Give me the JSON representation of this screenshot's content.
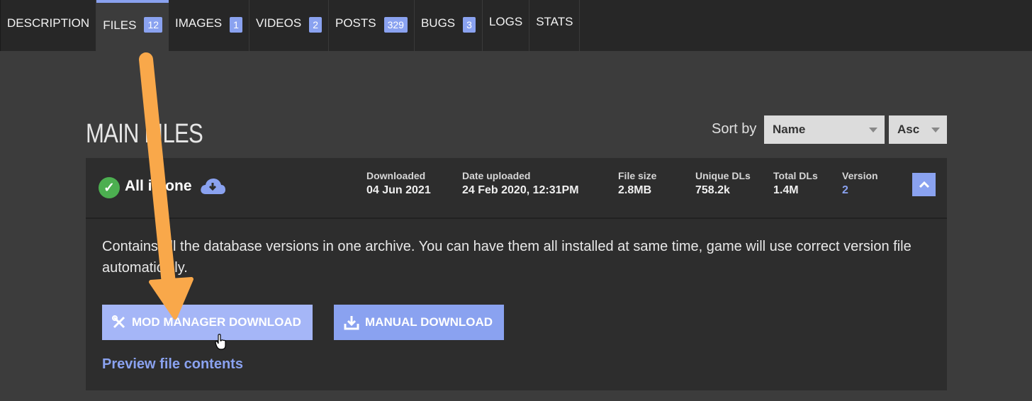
{
  "tabs": [
    {
      "label": "DESCRIPTION"
    },
    {
      "label": "FILES",
      "count": "12"
    },
    {
      "label": "IMAGES",
      "count": "1"
    },
    {
      "label": "VIDEOS",
      "count": "2"
    },
    {
      "label": "POSTS",
      "count": "329"
    },
    {
      "label": "BUGS",
      "count": "3"
    },
    {
      "label": "LOGS"
    },
    {
      "label": "STATS"
    }
  ],
  "active_tab": "FILES",
  "section": {
    "title": "MAIN FILES"
  },
  "sort": {
    "label": "Sort by",
    "field": "Name",
    "order": "Asc"
  },
  "file": {
    "name": "All in one",
    "stats": {
      "downloaded": {
        "label": "Downloaded",
        "value": "04 Jun 2021"
      },
      "date_uploaded": {
        "label": "Date uploaded",
        "value": "24 Feb 2020, 12:31PM"
      },
      "file_size": {
        "label": "File size",
        "value": "2.8MB"
      },
      "unique_dls": {
        "label": "Unique DLs",
        "value": "758.2k"
      },
      "total_dls": {
        "label": "Total DLs",
        "value": "1.4M"
      },
      "version": {
        "label": "Version",
        "value": "2"
      }
    },
    "description": "Contains all the database versions in one archive. You can have them all installed at same time, game will use correct version file automatically.",
    "buttons": {
      "mod_manager": "MOD MANAGER DOWNLOAD",
      "manual": "MANUAL DOWNLOAD"
    },
    "preview_link": "Preview file contents"
  },
  "colors": {
    "accent": "#8aa2f0",
    "accent_light": "#a5b6f7",
    "annotation_arrow": "#f9a84a",
    "check": "#4caf50"
  }
}
